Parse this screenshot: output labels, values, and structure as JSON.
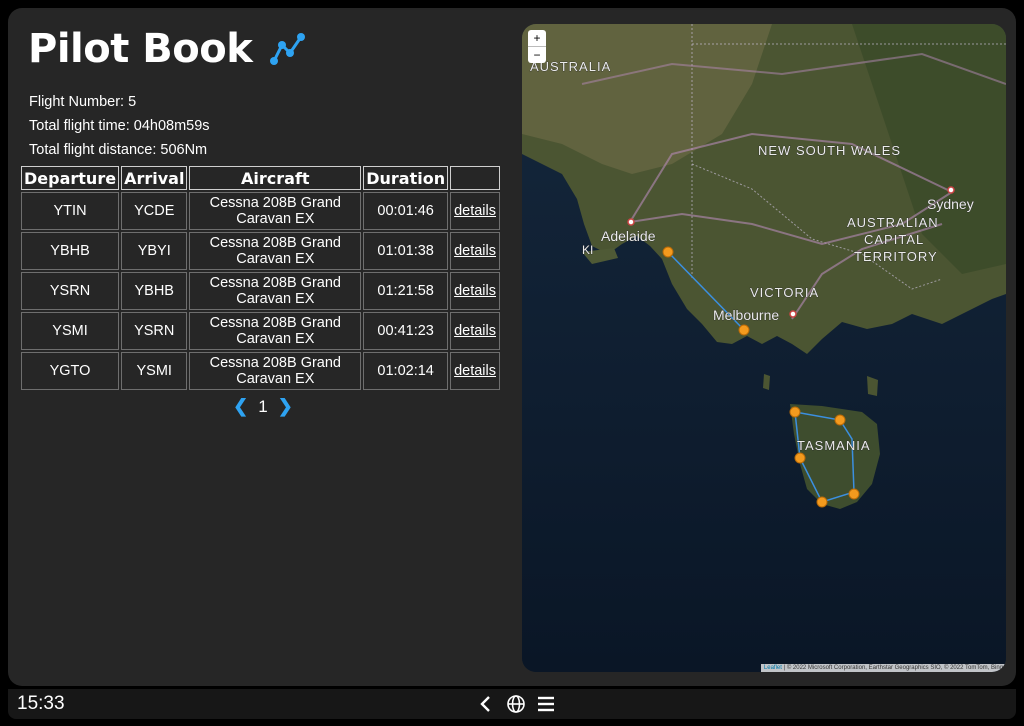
{
  "app": {
    "title": "Pilot Book"
  },
  "stats": {
    "flight_number": "Flight Number: 5",
    "total_time": "Total flight time: 04h08m59s",
    "total_distance": "Total flight distance: 506Nm"
  },
  "table": {
    "headers": [
      "Departure",
      "Arrival",
      "Aircraft",
      "Duration",
      ""
    ],
    "rows": [
      {
        "departure": "YTIN",
        "arrival": "YCDE",
        "aircraft": "Cessna 208B Grand Caravan EX",
        "duration": "00:01:46",
        "link": "details"
      },
      {
        "departure": "YBHB",
        "arrival": "YBYI",
        "aircraft": "Cessna 208B Grand Caravan EX",
        "duration": "01:01:38",
        "link": "details"
      },
      {
        "departure": "YSRN",
        "arrival": "YBHB",
        "aircraft": "Cessna 208B Grand Caravan EX",
        "duration": "01:21:58",
        "link": "details"
      },
      {
        "departure": "YSMI",
        "arrival": "YSRN",
        "aircraft": "Cessna 208B Grand Caravan EX",
        "duration": "00:41:23",
        "link": "details"
      },
      {
        "departure": "YGTO",
        "arrival": "YSMI",
        "aircraft": "Cessna 208B Grand Caravan EX",
        "duration": "01:02:14",
        "link": "details"
      }
    ]
  },
  "pager": {
    "page": "1"
  },
  "map": {
    "zoom_in": "+",
    "zoom_out": "−",
    "labels": {
      "australia": "AUSTRALIA",
      "nsw": "NEW SOUTH WALES",
      "sydney": "Sydney",
      "adelaide": "Adelaide",
      "ki": "KI",
      "act1": "AUSTRALIAN",
      "act2": "CAPITAL",
      "act3": "TERRITORY",
      "victoria": "VICTORIA",
      "melbourne": "Melbourne",
      "tasmania": "TASMANIA"
    },
    "attribution_link": "Leaflet",
    "attribution_text": " | © 2022 Microsoft Corporation, Earthstar Geographics SIO, © 2022 TomTom, Bing",
    "route_color": "#3b8fe0",
    "marker_color": "#f39a1e"
  },
  "taskbar": {
    "clock": "15:33"
  },
  "icons": {
    "header": "line-chart-icon",
    "pager_prev": "chevron-left-icon",
    "pager_next": "chevron-right-icon",
    "back": "back-icon",
    "globe": "globe-icon",
    "menu": "hamburger-menu-icon"
  }
}
